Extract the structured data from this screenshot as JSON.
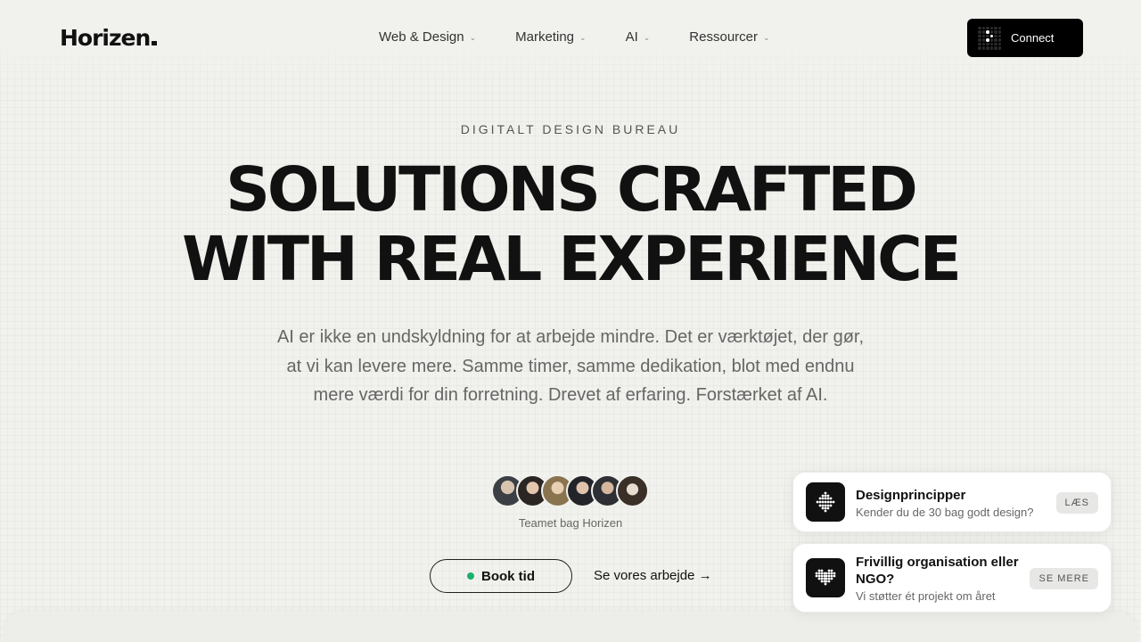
{
  "header": {
    "logo": "Horizen",
    "nav": [
      {
        "label": "Web & Design"
      },
      {
        "label": "Marketing"
      },
      {
        "label": "AI"
      },
      {
        "label": "Ressourcer"
      }
    ],
    "connect_label": "Connect"
  },
  "hero": {
    "eyebrow": "DIGITALT DESIGN BUREAU",
    "headline_line1": "SOLUTIONS CRAFTED",
    "headline_line2": "WITH REAL EXPERIENCE",
    "subtitle": "AI er ikke en undskyldning for at arbejde mindre. Det er værktøjet, der gør, at vi kan levere mere. Samme timer, samme dedikation, blot med endnu mere værdi for din forretning. Drevet af erfaring. Forstærket af AI.",
    "team_caption": "Teamet bag Horizen",
    "book_label": "Book tid",
    "work_link": "Se vores arbejde →"
  },
  "cards": [
    {
      "title": "Designprincipper",
      "desc": "Kender du de 30 bag godt design?",
      "button": "LÆS"
    },
    {
      "title": "Frivillig organisation eller NGO?",
      "desc": "Vi støtter ét projekt om året",
      "button": "SE MERE"
    }
  ],
  "colors": {
    "background": "#f1f1ed",
    "accent_dark": "#111111",
    "status_green": "#1ab26b"
  }
}
